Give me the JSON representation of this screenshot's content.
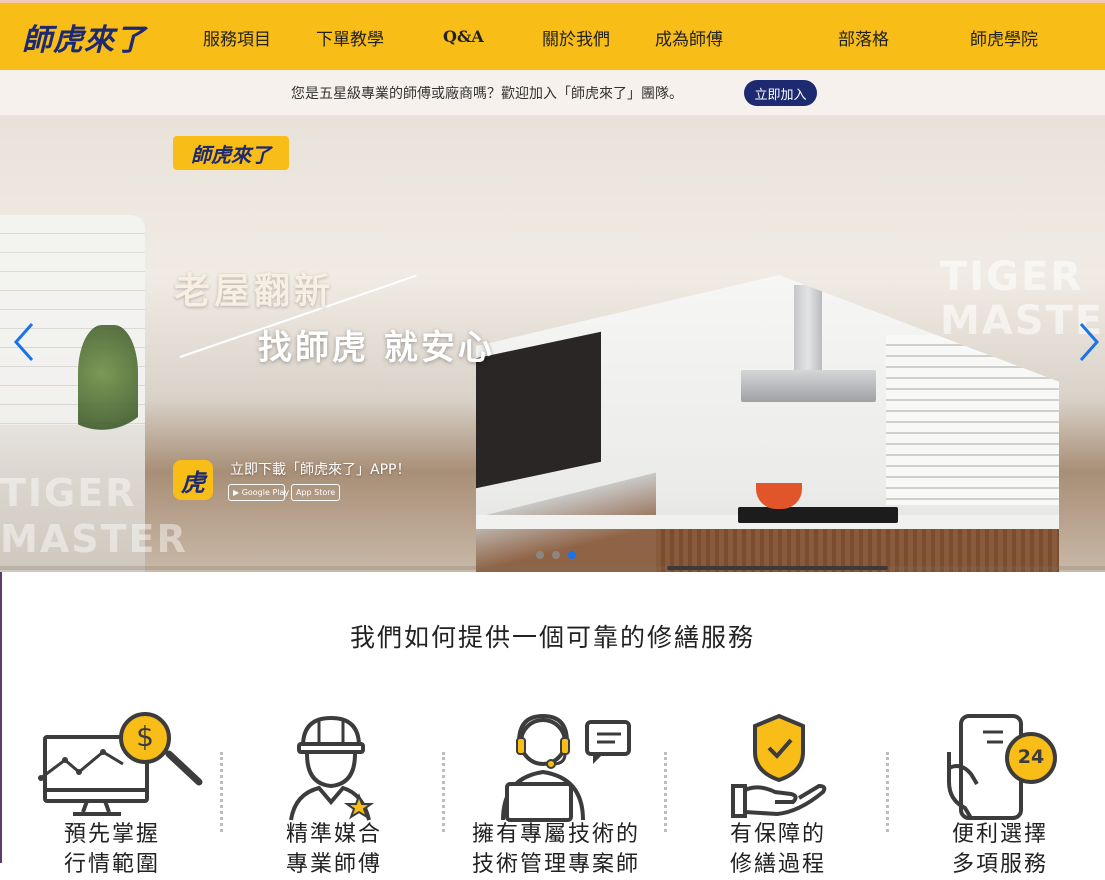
{
  "brand": {
    "logo_text": "師虎來了",
    "accent_color": "#f8bd17",
    "navy_color": "#1d2a72"
  },
  "nav": {
    "items": [
      "服務項目",
      "下單教學",
      "Q&A",
      "關於我們",
      "成為師傅",
      "部落格",
      "師虎學院"
    ]
  },
  "recruit": {
    "text": "您是五星級專業的師傅或廠商嗎？歡迎加入「師虎來了」團隊。",
    "button_label": "立即加入"
  },
  "hero": {
    "badge_text": "師虎來了",
    "slogan_line1": "老屋翻新",
    "slogan_line2": "找師虎 就安心",
    "watermark_right_line1": "TIGER",
    "watermark_right_line2": "MASTER",
    "watermark_left_line1": "TIGER",
    "watermark_left_line2": "MASTER",
    "app_icon_char": "虎",
    "app_download_text": "立即下載「師虎來了」APP！",
    "google_play_label": "▶ Google Play",
    "app_store_label": " App Store",
    "slide_count": 3,
    "active_slide": 3
  },
  "section": {
    "title": "我們如何提供一個可靠的修繕服務",
    "features": [
      {
        "icon": "market-research-icon",
        "line1": "預先掌握",
        "line2": "行情範圍"
      },
      {
        "icon": "worker-helmet-icon",
        "line1": "精準媒合",
        "line2": "專業師傅"
      },
      {
        "icon": "customer-service-icon",
        "line1": "擁有專屬技術的",
        "line2": "技術管理專案師"
      },
      {
        "icon": "shield-hand-icon",
        "line1": "有保障的",
        "line2": "修繕過程"
      },
      {
        "icon": "phone-24h-icon",
        "line1": "便利選擇",
        "line2": "多項服務"
      }
    ],
    "badge_24": "24",
    "dollar_sign": "$"
  }
}
